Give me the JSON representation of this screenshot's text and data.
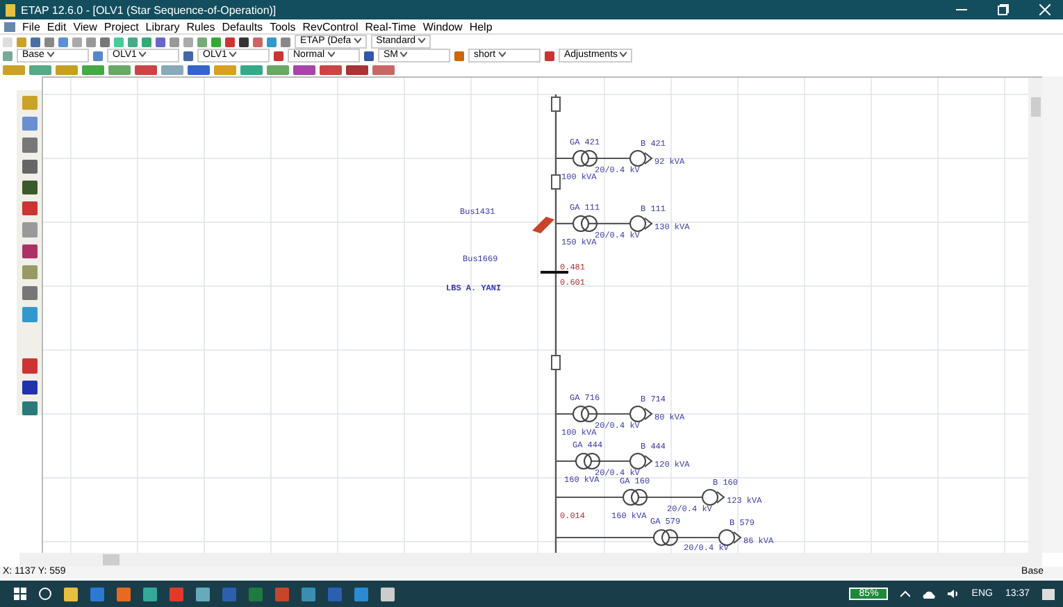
{
  "window": {
    "title": "ETAP 12.6.0 - [OLV1 (Star Sequence-of-Operation)]"
  },
  "menu": [
    "File",
    "Edit",
    "View",
    "Project",
    "Library",
    "Rules",
    "Defaults",
    "Tools",
    "RevControl",
    "Real-Time",
    "Window",
    "Help"
  ],
  "toolbar_row_1": {
    "dropdowns": [
      "ETAP (Defa",
      "Standard"
    ]
  },
  "toolbar_row_2": {
    "dropdowns": [
      "Base",
      "OLV1",
      "OLV1",
      "Normal",
      "SM",
      "short",
      "Adjustments"
    ]
  },
  "diagram": {
    "branches": [
      {
        "transformer": "GA 421",
        "rating": "100 kVA",
        "voltage": "20/0.4 kV",
        "load": "B 421",
        "load_kva": "92 kVA"
      },
      {
        "transformer": "GA 111",
        "rating": "150 kVA",
        "voltage": "20/0.4 kV",
        "load": "B 111",
        "load_kva": "130 kVA"
      },
      {
        "transformer": "GA 716",
        "rating": "100 kVA",
        "voltage": "20/0.4 kV",
        "load": "B 714",
        "load_kva": "80 kVA"
      },
      {
        "transformer": "GA 444",
        "rating": "160 kVA",
        "voltage": "20/0.4 kV",
        "load": "B 444",
        "load_kva": "120 kVA"
      },
      {
        "transformer": "GA 160",
        "rating": "160 kVA",
        "voltage": "20/0.4 kV",
        "load": "B 160",
        "load_kva": "123 kVA"
      },
      {
        "transformer": "GA 579",
        "voltage": "20/0.4 kV",
        "load": "B 579",
        "load_kva": "86 kVA"
      }
    ],
    "bus_labels": [
      "Bus1431",
      "Bus1669",
      "LBS A. YANI"
    ],
    "readings": [
      "0.481",
      "0.601",
      "0.014"
    ]
  },
  "status_bar": {
    "coordinates": "X: 1137   Y: 559",
    "mode": "Base"
  },
  "taskbar": {
    "battery": "85%",
    "language": "ENG",
    "time": "13:37"
  }
}
